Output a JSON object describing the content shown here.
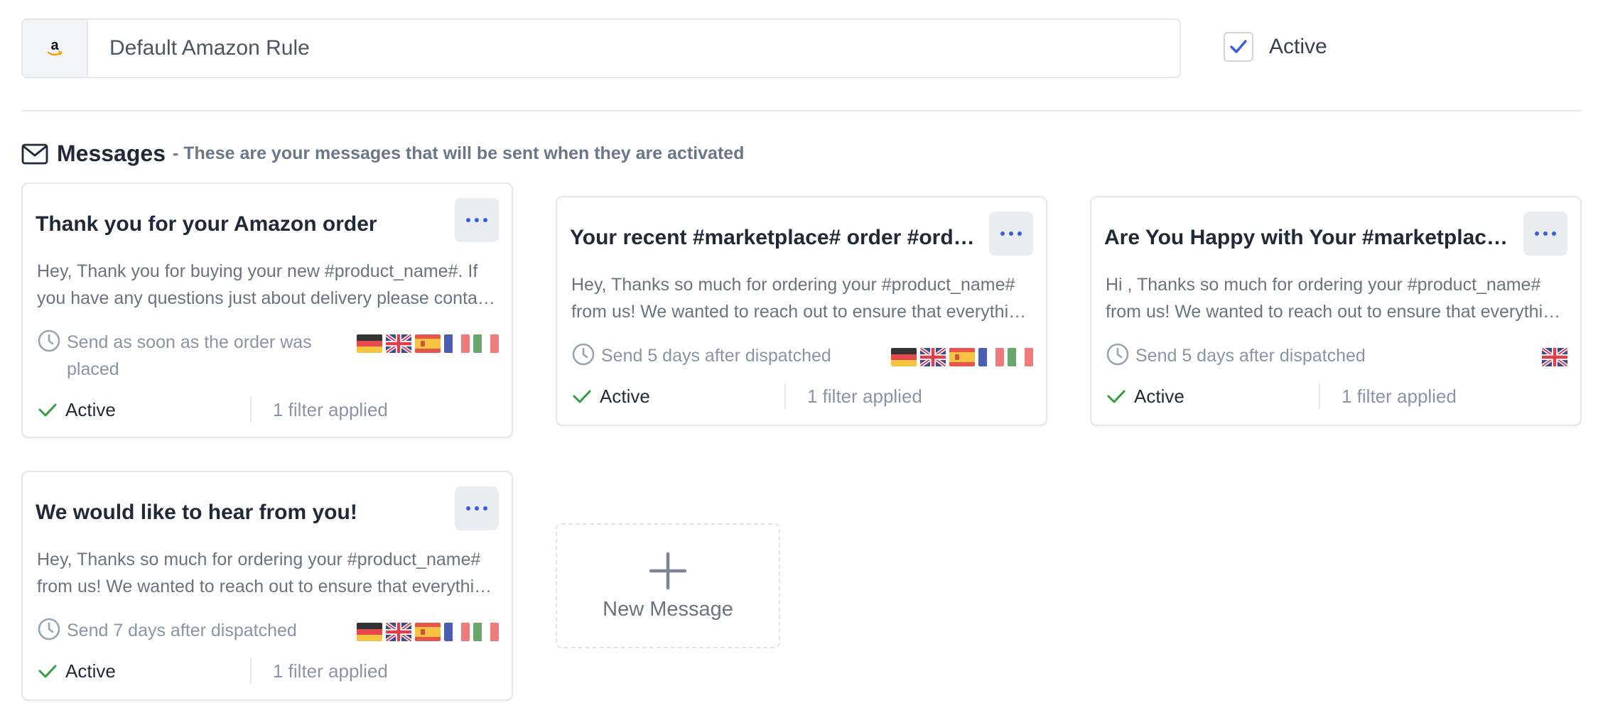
{
  "rule": {
    "name": "Default Amazon Rule",
    "active_label": "Active",
    "active": true
  },
  "section": {
    "title": "Messages",
    "subtitle": "- These are your messages that will be sent when they are activated"
  },
  "cards": [
    {
      "title": "Thank you for your Amazon order",
      "body": "Hey, Thank you for buying your new #product_name#. If you have any questions just about delivery please contact us.",
      "schedule": "Send as soon as the order was placed",
      "flags": [
        "de",
        "gb",
        "es",
        "fr",
        "it"
      ],
      "status": "Active",
      "filters": "1 filter applied"
    },
    {
      "title": "Your recent #marketplace# order #order_id#",
      "body": "Hey, Thanks so much for ordering your #product_name# from us! We wanted to reach out to ensure that everything arrived safely.",
      "schedule": "Send 5 days after dispatched",
      "flags": [
        "de",
        "gb",
        "es",
        "fr",
        "it"
      ],
      "status": "Active",
      "filters": "1 filter applied"
    },
    {
      "title": "Are You Happy with Your #marketplace# order?",
      "body": "Hi , Thanks so much for ordering your #product_name# from us! We wanted to reach out to ensure that everything arrived safely.",
      "schedule": "Send 5 days after dispatched",
      "flags": [
        "gb"
      ],
      "status": "Active",
      "filters": "1 filter applied"
    },
    {
      "title": "We would like to hear from you!",
      "body": "Hey, Thanks so much for ordering your #product_name# from us! We wanted to reach out to ensure that everything arrived safely.",
      "schedule": "Send 7 days after dispatched",
      "flags": [
        "de",
        "gb",
        "es",
        "fr",
        "it"
      ],
      "status": "Active",
      "filters": "1 filter applied"
    }
  ],
  "new_message": {
    "label": "New Message"
  },
  "colors": {
    "accent": "#3b5bdb",
    "check_green": "#2f9e44",
    "muted": "#8a94a6"
  }
}
